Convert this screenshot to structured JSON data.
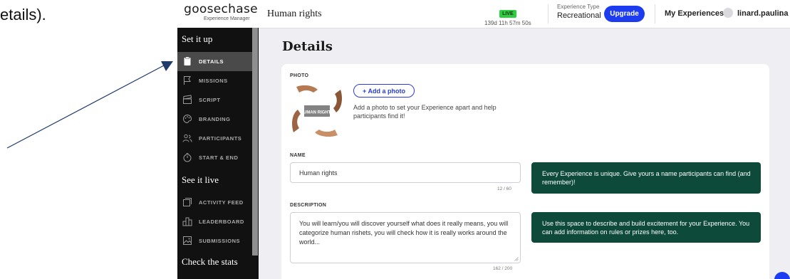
{
  "doc": {
    "fragment": "etails)."
  },
  "topbar": {
    "brand": "goosechase",
    "brand_sub": "Experience Manager",
    "experience_title": "Human rights",
    "live_label": "LIVE",
    "live_time": "139d 11h 57m 50s",
    "experience_type_label": "Experience Type",
    "experience_type_value": "Recreational",
    "upgrade_label": "Upgrade",
    "my_experiences_label": "My Experiences",
    "username": "linard.paulina",
    "dropdown_glyph": "↓"
  },
  "sidebar": {
    "sections": [
      {
        "title": "Set it up"
      },
      {
        "title": "See it live"
      },
      {
        "title": "Check the stats"
      }
    ],
    "items": [
      {
        "label": "DETAILS",
        "icon": "clipboard-icon",
        "active": true
      },
      {
        "label": "MISSIONS",
        "icon": "flag-icon",
        "active": false
      },
      {
        "label": "SCRIPT",
        "icon": "clapperboard-icon",
        "active": false
      },
      {
        "label": "BRANDING",
        "icon": "palette-icon",
        "active": false
      },
      {
        "label": "PARTICIPANTS",
        "icon": "people-icon",
        "active": false
      },
      {
        "label": "START & END",
        "icon": "stopwatch-icon",
        "active": false
      },
      {
        "label": "ACTIVITY FEED",
        "icon": "feed-icon",
        "active": false
      },
      {
        "label": "LEADERBOARD",
        "icon": "leaderboard-icon",
        "active": false
      },
      {
        "label": "SUBMISSIONS",
        "icon": "image-icon",
        "active": false
      }
    ]
  },
  "main": {
    "page_title": "Details",
    "photo": {
      "label": "PHOTO",
      "image_text": "HUMAN RIGHTS",
      "add_button": "+ Add a photo",
      "help": "Add a photo to set your Experience apart and help participants find it!"
    },
    "name": {
      "label": "NAME",
      "value": "Human rights",
      "counter": "12 / 60",
      "tip": "Every Experience is unique. Give yours a name participants can find (and remember)!"
    },
    "description": {
      "label": "DESCRIPTION",
      "value": "You will learn/you will discover yourself what does it really means, you will categorize human rishets, you will check how it is really works around the world...",
      "counter": "162 / 200",
      "tip": "Use this space to describe and build excitement for your Experience. You can add information on rules or prizes here, too."
    }
  },
  "colors": {
    "sidebar_bg": "#111111",
    "active_item_bg": "#4a4a4a",
    "upgrade_blue": "#1d3cf0",
    "tip_green": "#0e4a3a",
    "live_green": "#2ecc40",
    "arrow_blue": "#1f3a6b"
  }
}
